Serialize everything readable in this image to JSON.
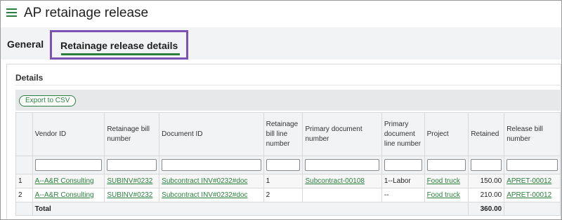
{
  "header": {
    "title": "AP retainage release"
  },
  "tabs": {
    "general": "General",
    "details": "Retainage release details"
  },
  "section": {
    "title": "Details",
    "export_label": "Export to CSV"
  },
  "grid": {
    "columns": [
      "",
      "Vendor ID",
      "Retainage bill number",
      "Document ID",
      "Retainage bill line number",
      "Primary document number",
      "Primary document line number",
      "Project",
      "Retained",
      "Release bill number"
    ],
    "rows": [
      {
        "num": "1",
        "vendor": "A--A&R Consulting",
        "bill": "SUBINV#0232",
        "doc": "Subcontract INV#0232#doc",
        "line": "1",
        "primary_doc": "Subcontract-00108",
        "primary_line": "1--Labor",
        "project": "Food truck",
        "retained": "150.00",
        "release": "APRET-00012"
      },
      {
        "num": "2",
        "vendor": "A--A&R Consulting",
        "bill": "SUBINV#0232",
        "doc": "Subcontract INV#0232#doc",
        "line": "2",
        "primary_doc": "",
        "primary_line": "--",
        "project": "Food truck",
        "retained": "210.00",
        "release": "APRET-00012"
      }
    ],
    "total": {
      "label": "Total",
      "retained": "360.00"
    }
  },
  "colors": {
    "accent": "#2a7f3f",
    "highlight_border": "#7b52b3"
  },
  "icons": {
    "menu": "list-menu-icon"
  }
}
